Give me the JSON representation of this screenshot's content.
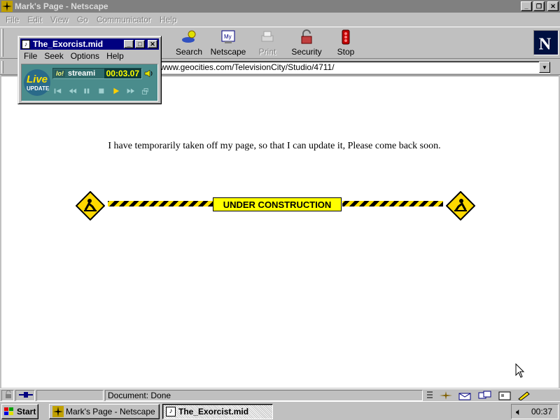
{
  "window": {
    "title": "Mark's Page - Netscape"
  },
  "menubar": [
    "File",
    "Edit",
    "View",
    "Go",
    "Communicator",
    "Help"
  ],
  "toolbar": {
    "buttons": [
      {
        "label": "Search",
        "icon": "search-icon"
      },
      {
        "label": "Netscape",
        "icon": "my-netscape-icon"
      },
      {
        "label": "Print",
        "icon": "print-icon"
      },
      {
        "label": "Security",
        "icon": "security-lock-icon"
      },
      {
        "label": "Stop",
        "icon": "stop-icon"
      }
    ]
  },
  "location": {
    "url": "www.geocities.com/TelevisionCity/Studio/4711/"
  },
  "page": {
    "message": "I have temporarily taken off my page, so that I can update it, Please come back soon.",
    "banner_text": "UNDER CONSTRUCTION"
  },
  "status": {
    "text": "Document: Done"
  },
  "player": {
    "title": "The_Exorcist.mid",
    "menu": [
      "File",
      "Seek",
      "Options",
      "Help"
    ],
    "logo_line1": "Live",
    "logo_line2": "UPDATE",
    "badge": "lo!",
    "stream": "streami",
    "time": "00:03.07"
  },
  "taskbar": {
    "start": "Start",
    "tasks": [
      "Mark's Page - Netscape",
      "The_Exorcist.mid"
    ],
    "clock": "00:37"
  },
  "colors": {
    "titlebar_inactive": "#808080",
    "titlebar_active": "#000080",
    "desktop_gray": "#c0c0c0",
    "construction_yellow": "#ffff00"
  }
}
